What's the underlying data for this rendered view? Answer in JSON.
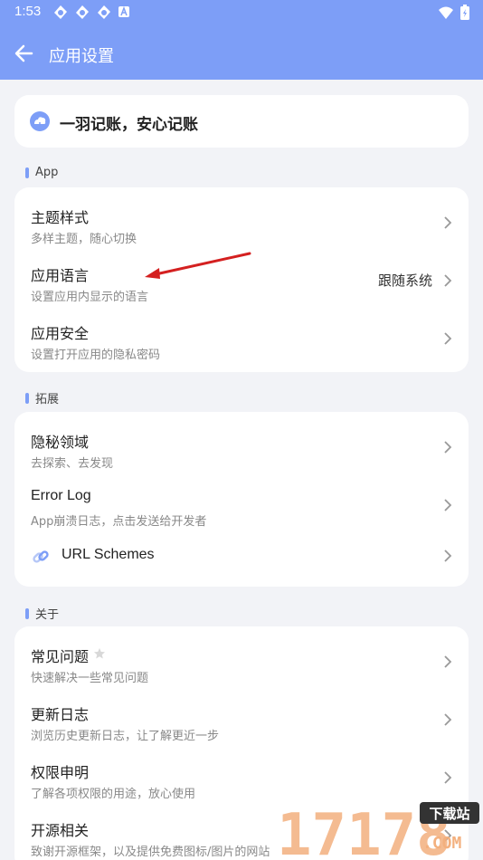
{
  "status_bar": {
    "time": "1:53",
    "icons": [
      "sync-icon",
      "sync-icon",
      "sync-icon",
      "a-icon"
    ],
    "right_icons": [
      "wifi-icon",
      "battery-icon"
    ]
  },
  "app_bar": {
    "title": "应用设置",
    "back_icon": "arrow-left-icon"
  },
  "slogan": {
    "icon": "cloud-icon",
    "text": "一羽记账，安心记账"
  },
  "sections": {
    "app": {
      "title": "App",
      "items": [
        {
          "title": "主题样式",
          "subtitle": "多样主题，随心切换"
        },
        {
          "title": "应用语言",
          "subtitle": "设置应用内显示的语言",
          "value": "跟随系统"
        },
        {
          "title": "应用安全",
          "subtitle": "设置打开应用的隐私密码"
        }
      ]
    },
    "extend": {
      "title": "拓展",
      "items": [
        {
          "title": "隐秘领域",
          "subtitle": "去探索、去发现"
        },
        {
          "title": "Error Log",
          "subtitle": "App崩溃日志，点击发送给开发者"
        },
        {
          "title": "URL Schemes",
          "icon": "link-icon"
        }
      ]
    },
    "about": {
      "title": "关于",
      "items": [
        {
          "title": "常见问题",
          "subtitle": "快速解决一些常见问题",
          "icon": "star-icon"
        },
        {
          "title": "更新日志",
          "subtitle": "浏览历史更新日志，让了解更近一步"
        },
        {
          "title": "权限申明",
          "subtitle": "了解各项权限的用途，放心使用"
        },
        {
          "title": "开源相关",
          "subtitle": "致谢开源框架，以及提供免费图标/图片的网站"
        }
      ]
    }
  },
  "watermark": {
    "text": "17178",
    "badge": "下载站",
    "suffix": ".COM"
  },
  "colors": {
    "accent": "#7d9ef7",
    "background": "#f2f3f7",
    "arrow": "#d42020"
  }
}
